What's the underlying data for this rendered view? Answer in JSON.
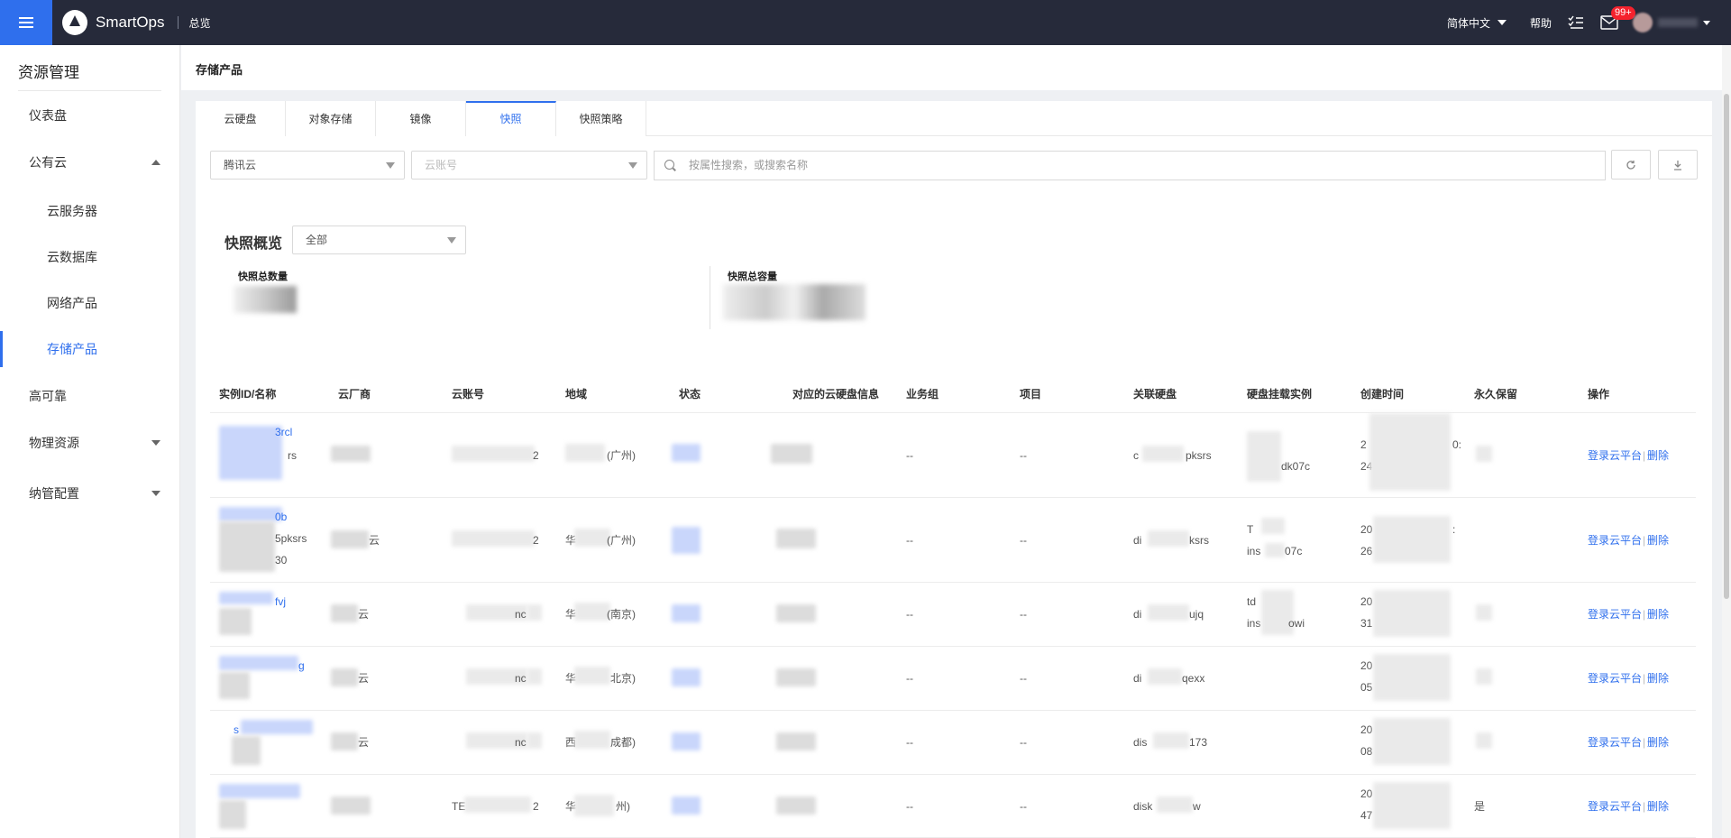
{
  "header": {
    "app_name": "SmartOps",
    "nav": "总览",
    "language": "简体中文",
    "help": "帮助",
    "mail_badge": "99+"
  },
  "sidebar": {
    "title": "资源管理",
    "items": [
      {
        "label": "仪表盘"
      },
      {
        "label": "公有云"
      },
      {
        "label": "云服务器"
      },
      {
        "label": "云数据库"
      },
      {
        "label": "网络产品"
      },
      {
        "label": "存储产品"
      },
      {
        "label": "高可靠"
      },
      {
        "label": "物理资源"
      },
      {
        "label": "纳管配置"
      }
    ]
  },
  "page": {
    "title": "存储产品"
  },
  "tabs": [
    "云硬盘",
    "对象存储",
    "镜像",
    "快照",
    "快照策略"
  ],
  "active_tab": "快照",
  "filters": {
    "provider": "腾讯云",
    "account_placeholder": "云账号",
    "search_placeholder": "按属性搜索，或搜索名称"
  },
  "overview": {
    "title": "快照概览",
    "scope": "全部",
    "count_label": "快照总数量",
    "capacity_label": "快照总容量"
  },
  "table": {
    "columns": [
      "实例ID/名称",
      "云厂商",
      "云账号",
      "地域",
      "状态",
      "对应的云硬盘信息",
      "业务组",
      "项目",
      "关联硬盘",
      "硬盘挂载实例",
      "创建时间",
      "永久保留",
      "操作"
    ],
    "rows": [
      {
        "id_line1": "3rcl",
        "id_line2": "rs",
        "provider": "",
        "account": "2",
        "region": "(广州)",
        "bizgroup": "--",
        "project": "--",
        "disk": "pksrs",
        "disk_prefix": "c",
        "mount_line1": "",
        "mount_line2": "dk07c",
        "time_line1": "2",
        "time_line2": "24",
        "time_suffix": "0:",
        "permanent": ""
      },
      {
        "id_line1": "0b",
        "id_line2": "5pksrs",
        "id_line3": "30",
        "provider": "云",
        "account": "2",
        "region": "(广州)",
        "region_prefix": "华",
        "bizgroup": "--",
        "project": "--",
        "disk": "ksrs",
        "disk_prefix": "di",
        "mount_line1": "T",
        "mount_line2": "ins",
        "mount_line2b": "07c",
        "time_line1": "20",
        "time_line2": "26",
        "time_suffix": ":",
        "permanent": ""
      },
      {
        "id_line1": "fvj",
        "id_line2": "",
        "provider": "云",
        "account": "nc",
        "region": "(南京)",
        "region_prefix": "华",
        "bizgroup": "--",
        "project": "--",
        "disk": "ujq",
        "disk_prefix": "di",
        "mount_line1": "td",
        "mount_line2": "ins",
        "mount_line2b": "owi",
        "time_line1": "20",
        "time_line2": "31",
        "time_suffix": "",
        "permanent": ""
      },
      {
        "id_line1": "g",
        "id_line2": "",
        "provider": "云",
        "account": "nc",
        "region": "北京)",
        "region_prefix": "华",
        "bizgroup": "--",
        "project": "--",
        "disk": "qexx",
        "disk_prefix": "di",
        "mount_line1": "",
        "mount_line2": "",
        "time_line1": "20",
        "time_line2": "05",
        "time_suffix": "",
        "permanent": ""
      },
      {
        "id_line1": "s",
        "id_line2": "",
        "provider": "云",
        "account": "nc",
        "region": "成都)",
        "region_prefix": "西",
        "bizgroup": "--",
        "project": "--",
        "disk": "173",
        "disk_prefix": "dis",
        "mount_line1": "",
        "mount_line2": "",
        "time_line1": "20",
        "time_line2": "08",
        "time_suffix": "",
        "permanent": ""
      },
      {
        "id_line1": "",
        "id_line2": "",
        "provider": "",
        "account": "2",
        "account_prefix": "TE",
        "region": "州)",
        "region_prefix": "华",
        "bizgroup": "--",
        "project": "--",
        "disk": "w",
        "disk_prefix": "disk",
        "mount_line1": "",
        "mount_line2": "",
        "time_line1": "20",
        "time_line2": "47",
        "time_suffix": "",
        "permanent": "是"
      }
    ],
    "action_login": "登录云平台",
    "action_delete": "删除"
  }
}
